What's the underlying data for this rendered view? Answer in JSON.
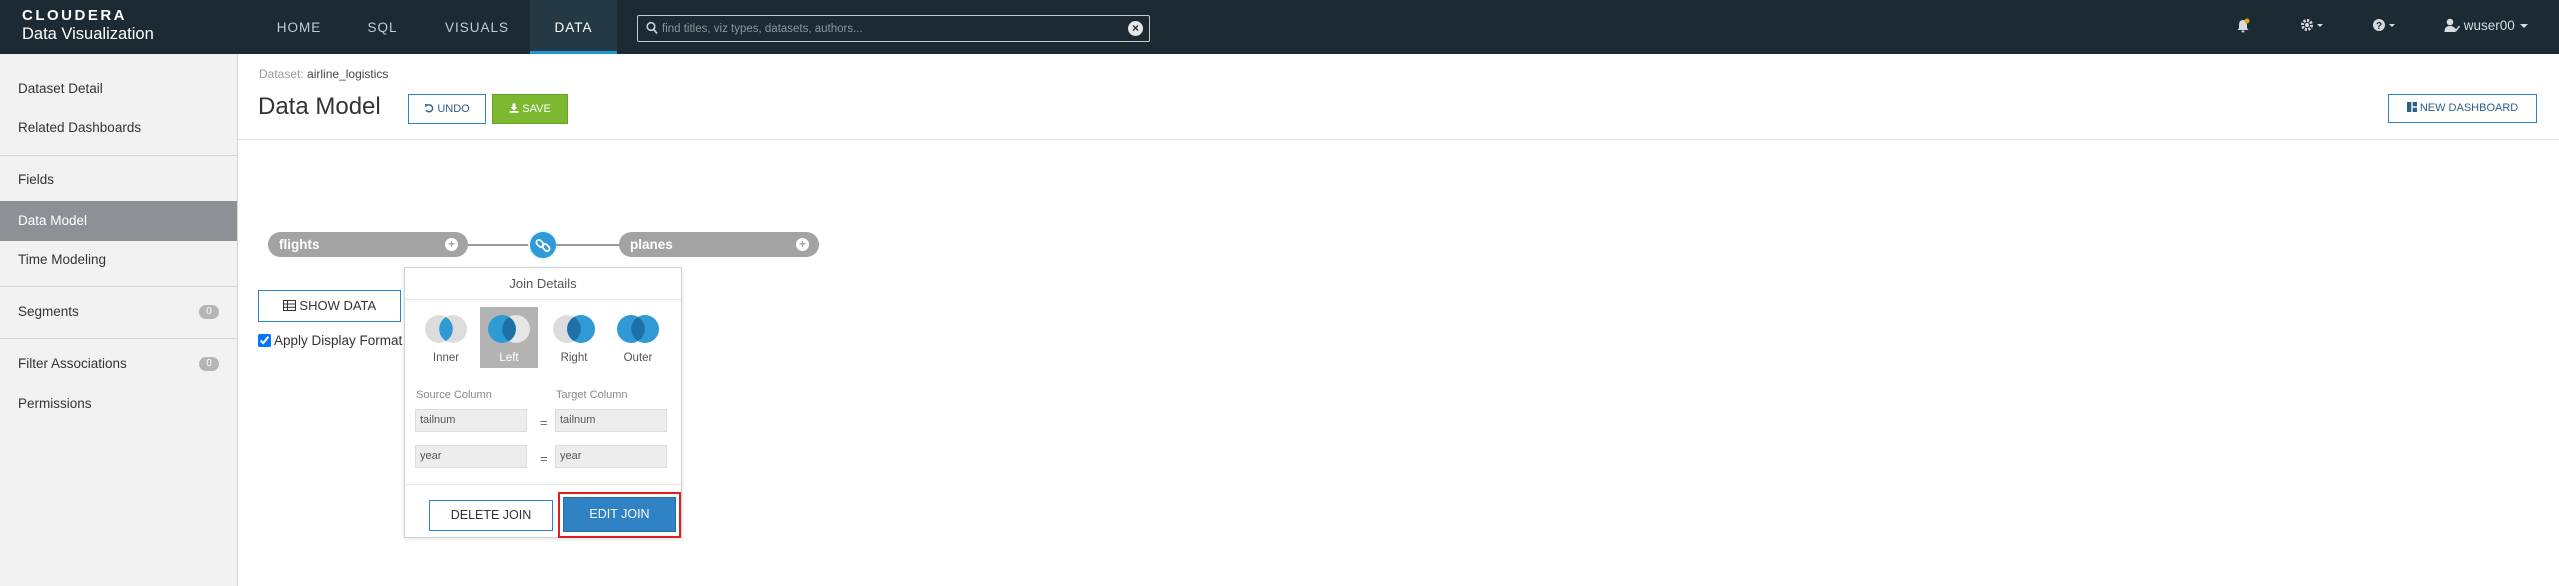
{
  "brand": {
    "company": "CLOUDERA",
    "product": "Data Visualization"
  },
  "nav": {
    "tabs": [
      {
        "label": "HOME"
      },
      {
        "label": "SQL"
      },
      {
        "label": "VISUALS"
      },
      {
        "label": "DATA",
        "active": true
      }
    ],
    "search_placeholder": "find titles, viz types, datasets, authors...",
    "user": "wuser00"
  },
  "sidebar": {
    "items": [
      {
        "label": "Dataset Detail"
      },
      {
        "label": "Related Dashboards"
      },
      {
        "label": "Fields"
      },
      {
        "label": "Data Model",
        "active": true
      },
      {
        "label": "Time Modeling"
      },
      {
        "label": "Segments",
        "badge": "0"
      },
      {
        "label": "Filter Associations",
        "badge": "0"
      },
      {
        "label": "Permissions"
      }
    ]
  },
  "header": {
    "dataset_label": "Dataset:",
    "dataset_name": "airline_logistics",
    "title": "Data Model",
    "undo_label": "UNDO",
    "save_label": "SAVE",
    "new_dashboard_label": "NEW DASHBOARD"
  },
  "model": {
    "left_table": "flights",
    "right_table": "planes",
    "show_data_label": "SHOW DATA",
    "apply_format_label": "Apply Display Format",
    "apply_format_checked": true
  },
  "join_details": {
    "title": "Join Details",
    "types": [
      {
        "label": "Inner"
      },
      {
        "label": "Left",
        "selected": true
      },
      {
        "label": "Right"
      },
      {
        "label": "Outer"
      }
    ],
    "source_column_label": "Source Column",
    "target_column_label": "Target Column",
    "pairs": [
      {
        "source": "tailnum",
        "op": "=",
        "target": "tailnum"
      },
      {
        "source": "year",
        "op": "=",
        "target": "year"
      }
    ],
    "delete_label": "DELETE JOIN",
    "edit_label": "EDIT JOIN"
  },
  "colors": {
    "topbar": "#1b2a33",
    "accent_blue": "#2e9ad6",
    "save_green": "#7cb830",
    "highlight_red": "#e02020"
  }
}
